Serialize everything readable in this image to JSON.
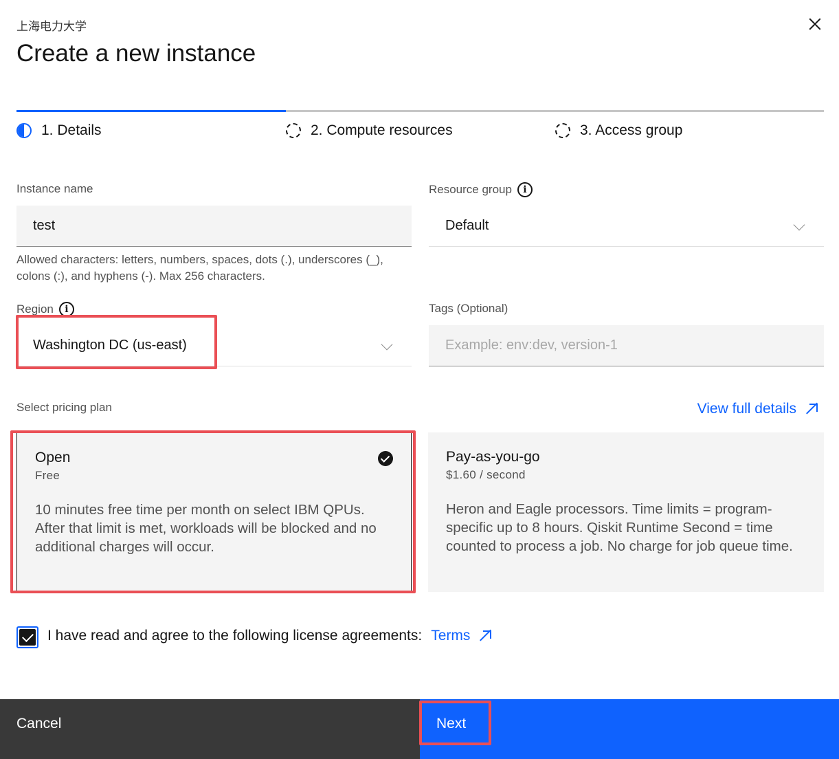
{
  "org_name": "上海电力大学",
  "title": "Create a new instance",
  "steps": [
    {
      "label": "1. Details",
      "state": "current"
    },
    {
      "label": "2. Compute resources",
      "state": "incomplete"
    },
    {
      "label": "3. Access group",
      "state": "incomplete"
    }
  ],
  "instance_name": {
    "label": "Instance name",
    "value": "test",
    "helper": "Allowed characters: letters, numbers, spaces, dots (.), underscores (_), colons (:), and hyphens (-). Max 256 characters."
  },
  "resource_group": {
    "label": "Resource group",
    "value": "Default"
  },
  "region": {
    "label": "Region",
    "value": "Washington DC (us-east)"
  },
  "tags": {
    "label": "Tags (Optional)",
    "placeholder": "Example: env:dev, version-1"
  },
  "pricing": {
    "label": "Select pricing plan",
    "view_details": "View full details",
    "plans": [
      {
        "name": "Open",
        "price": "Free",
        "description": "10 minutes free time per month on select IBM QPUs. After that limit is met, workloads will be blocked and no additional charges will occur.",
        "selected": true
      },
      {
        "name": "Pay-as-you-go",
        "price": "$1.60 / second",
        "description": "Heron and Eagle processors. Time limits = program-specific up to 8 hours. Qiskit Runtime Second = time counted to process a job. No charge for job queue time.",
        "selected": false
      }
    ]
  },
  "agreement": {
    "text": "I have read and agree to the following license agreements:",
    "link": "Terms",
    "checked": true
  },
  "footer": {
    "cancel": "Cancel",
    "next": "Next"
  },
  "colors": {
    "accent": "#0f62fe",
    "highlight": "#ea4f55"
  }
}
